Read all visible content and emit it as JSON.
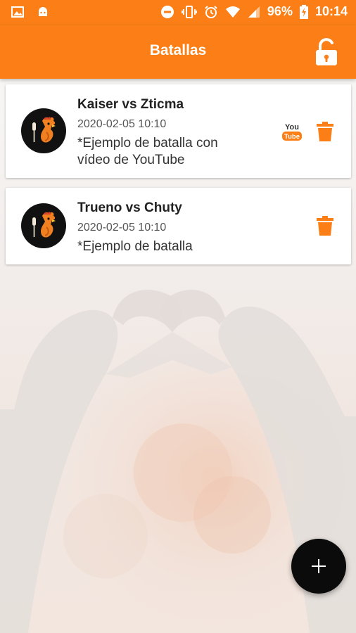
{
  "status_bar": {
    "battery": "96%",
    "time": "10:14",
    "icons": [
      "image-icon",
      "android-icon",
      "do-not-disturb-icon",
      "vibrate-icon",
      "alarm-icon",
      "wifi-icon",
      "signal-icon",
      "battery-charging-icon"
    ]
  },
  "app_bar": {
    "title": "Batallas",
    "lock_icon": "unlock-icon"
  },
  "battles": [
    {
      "title": "Kaiser vs Zticma",
      "date": "2020-02-05 10:10",
      "description": "*Ejemplo de batalla con vídeo de YouTube",
      "has_youtube": true,
      "youtube_top": "You",
      "youtube_bottom": "Tube"
    },
    {
      "title": "Trueno vs Chuty",
      "date": "2020-02-05 10:10",
      "description": "*Ejemplo de batalla",
      "has_youtube": false
    }
  ],
  "fab": {
    "icon": "plus-icon"
  },
  "colors": {
    "primary": "#fb7f16",
    "fab": "#0b0b0b",
    "card": "#ffffff"
  }
}
